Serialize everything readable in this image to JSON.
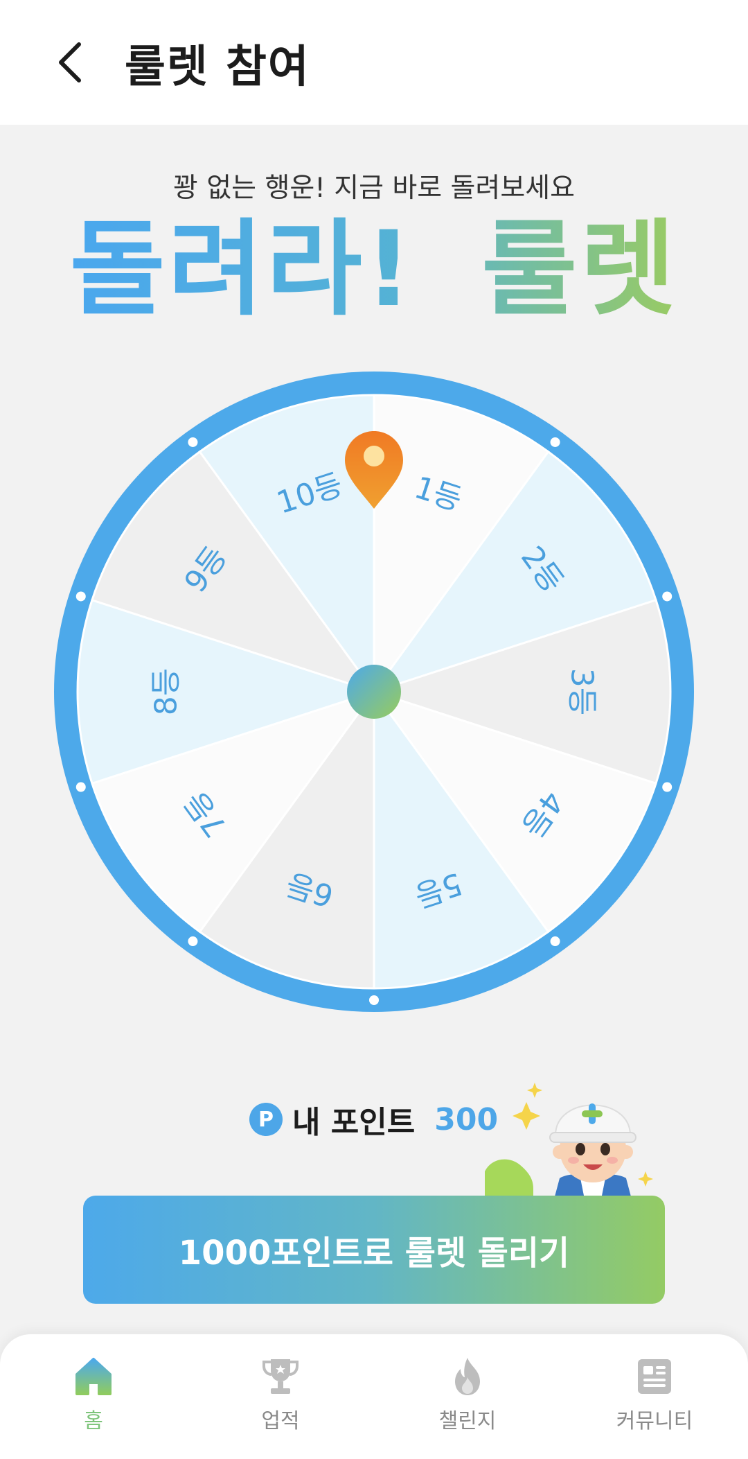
{
  "header": {
    "title": "룰렛 참여"
  },
  "hero": {
    "subtitle": "꽝 없는 행운! 지금 바로 돌려보세요",
    "title_part1": "돌려라!",
    "title_part2": "룰렛"
  },
  "wheel": {
    "segments": [
      "1등",
      "2등",
      "3등",
      "4등",
      "5등",
      "6등",
      "7등",
      "8등",
      "9등",
      "10등"
    ],
    "segment_colors": [
      "#fbfbfb",
      "#e6f5fc",
      "#efefef",
      "#fbfbfb",
      "#e6f5fc",
      "#efefef",
      "#fbfbfb",
      "#e6f5fc",
      "#efefef",
      "#e6f5fc"
    ],
    "rim_color": "#4da9ea",
    "label_color": "#4a9fdd",
    "pointer_color": "#f08a2c"
  },
  "points": {
    "badge": "P",
    "label": "내 포인트",
    "value": "300"
  },
  "spin_button": {
    "label": "1000포인트로 룰렛 돌리기"
  },
  "nav": {
    "items": [
      {
        "label": "홈",
        "icon": "home-icon",
        "active": true
      },
      {
        "label": "업적",
        "icon": "trophy-icon",
        "active": false
      },
      {
        "label": "챌린지",
        "icon": "flame-icon",
        "active": false
      },
      {
        "label": "커뮤니티",
        "icon": "news-icon",
        "active": false
      }
    ]
  },
  "colors": {
    "accent_blue": "#4da9ea",
    "accent_green": "#94cb64",
    "background": "#f2f2f2"
  }
}
